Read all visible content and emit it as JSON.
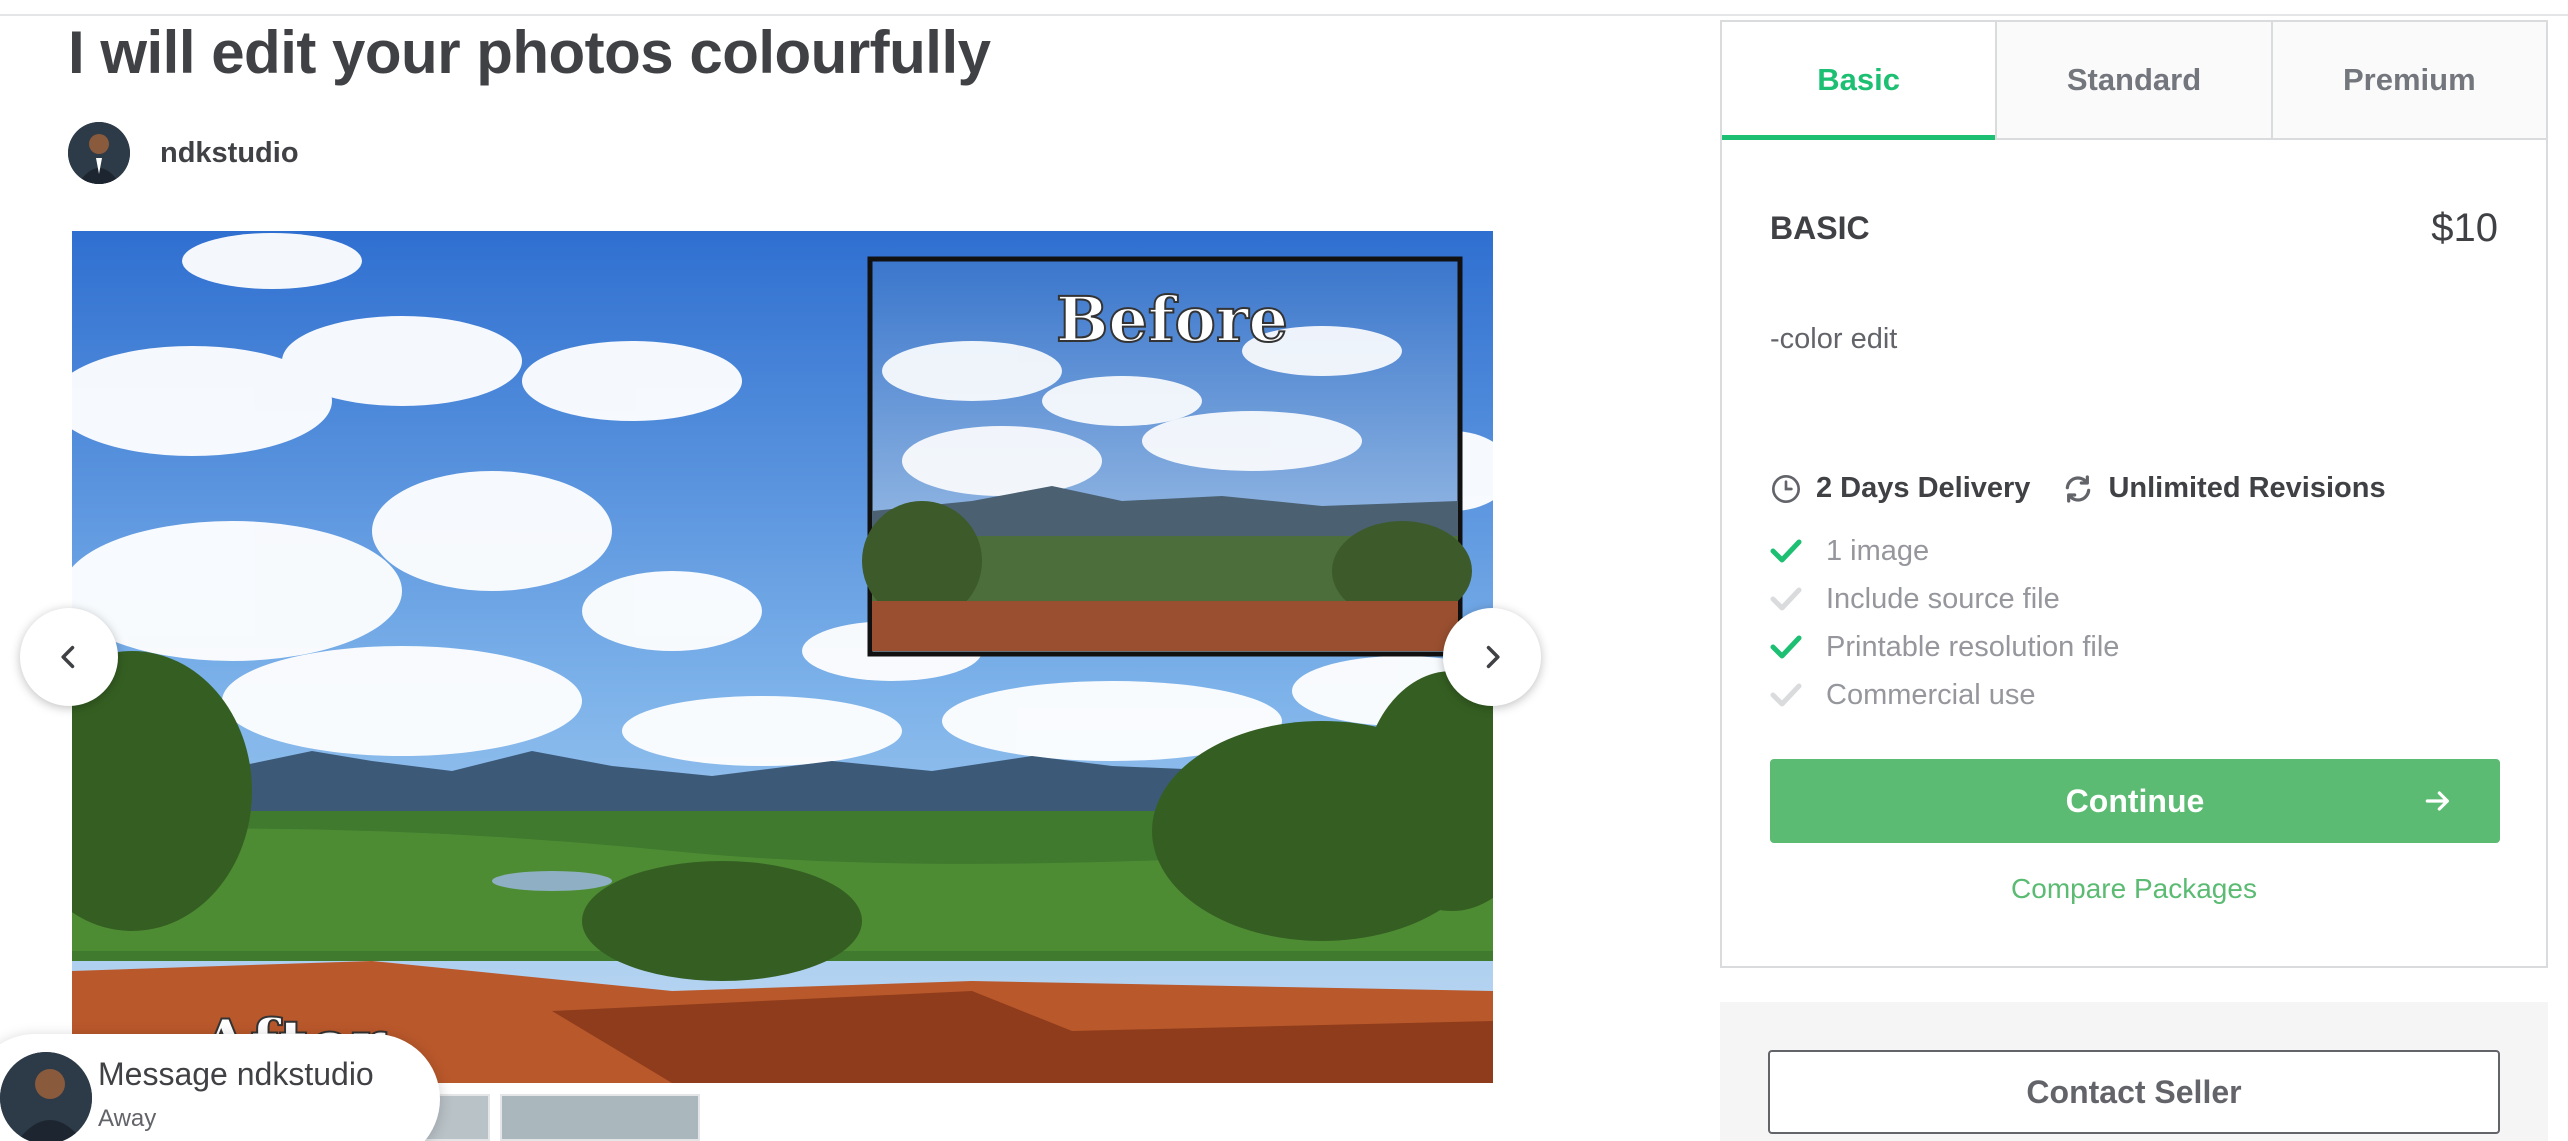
{
  "gig": {
    "title": "I will edit your photos colourfully",
    "seller": "ndkstudio"
  },
  "gallery": {
    "before_label": "Before",
    "after_label": "After"
  },
  "chat": {
    "label": "Message ndkstudio",
    "status": "Away"
  },
  "packages": {
    "tabs": [
      "Basic",
      "Standard",
      "Premium"
    ],
    "active_tab": "Basic",
    "name": "BASIC",
    "price": "$10",
    "description": "-color edit",
    "delivery": "2 Days Delivery",
    "revisions": "Unlimited Revisions",
    "features": [
      {
        "label": "1 image",
        "included": true
      },
      {
        "label": "Include source file",
        "included": false
      },
      {
        "label": "Printable resolution file",
        "included": true
      },
      {
        "label": "Commercial use",
        "included": false
      }
    ],
    "continue_label": "Continue",
    "compare_label": "Compare Packages",
    "contact_label": "Contact Seller"
  },
  "colors": {
    "accent": "#1dbf73",
    "button": "#5bbb72",
    "text": "#404145",
    "muted": "#95979d"
  },
  "icons": {
    "prev": "chevron-left-icon",
    "next": "chevron-right-icon",
    "delivery": "clock-icon",
    "revisions": "refresh-icon",
    "continue": "arrow-right-icon",
    "feature": "check-icon"
  }
}
